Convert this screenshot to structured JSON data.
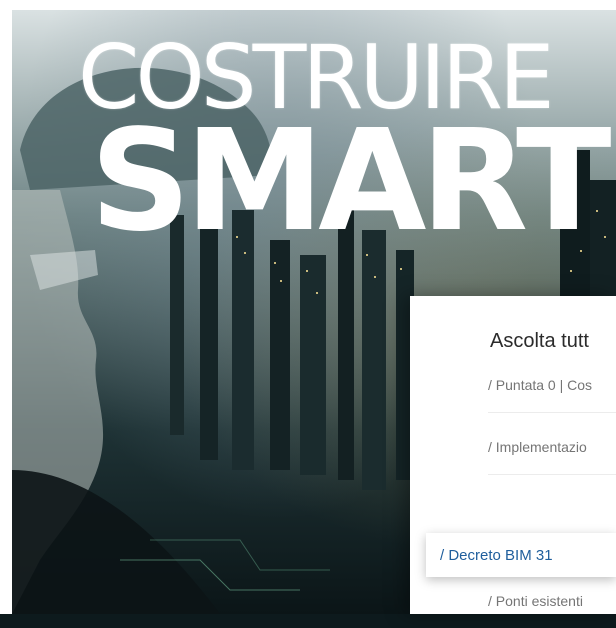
{
  "hero": {
    "logo_line1": "COSTRUIRE",
    "logo_line2": "SMART"
  },
  "panel": {
    "title": "Ascolta tutt",
    "episodes": [
      {
        "label": "/ Puntata 0 | Cos",
        "active": false
      },
      {
        "label": "/ Implementazio",
        "active": false
      },
      {
        "label": "/ Decreto BIM 31",
        "active": true
      },
      {
        "label": "/ Ponti esistenti",
        "active": false
      }
    ]
  },
  "colors": {
    "accent": "#1f5e9c",
    "panel_bg": "#ffffff",
    "text_dark": "#2b2b2b",
    "text_muted": "#757575"
  }
}
